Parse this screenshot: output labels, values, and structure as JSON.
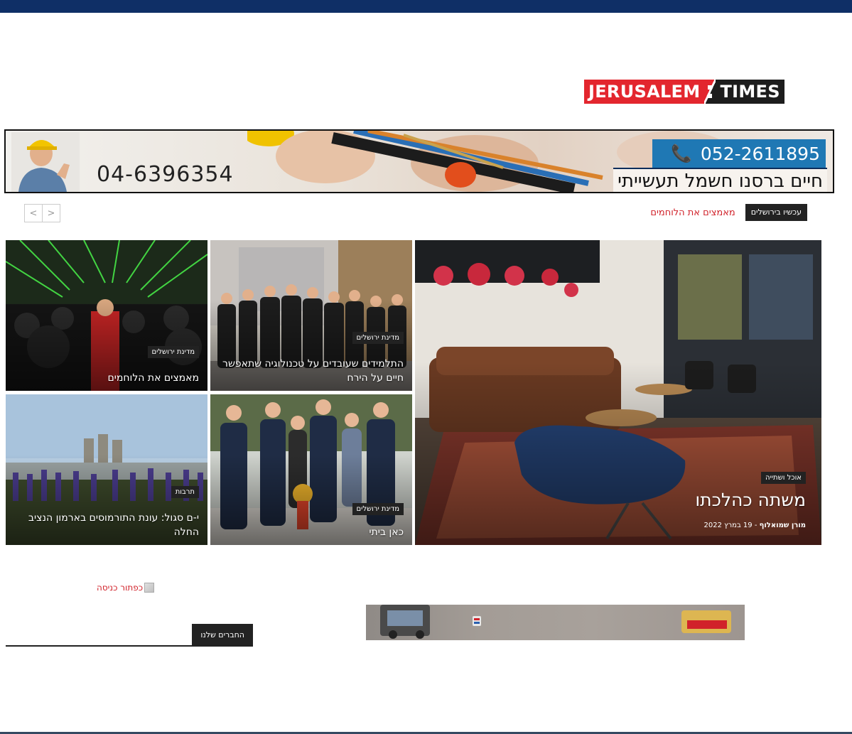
{
  "logo": {
    "part1": "JERUSALEM",
    "part2": "TIMES"
  },
  "banner": {
    "phone_left": "04-6396354",
    "phone_right": "052-2611895",
    "slogan": "חיים ברסנו חשמל תעשייתי",
    "phone_icon": "phone-icon"
  },
  "nav": {
    "prev": "<",
    "next": ">"
  },
  "ticker": {
    "label": "עכשיו בירושלים",
    "headline": "מאמצים את הלוחמים"
  },
  "featured": {
    "big": {
      "category": "אוכל ושתייה",
      "title": "משתה כהלכתו",
      "author": "מורן שמואלוף",
      "date": "19 במרץ 2022",
      "sep": " - "
    },
    "tiles": [
      {
        "category": "מדינת ירושלים",
        "title": "התלמידים שעובדים על טכנולוגיה שתאפשר חיים על הירח"
      },
      {
        "category": "מדינת ירושלים",
        "title": "מאמצים את הלוחמים"
      },
      {
        "category": "מדינת ירושלים",
        "title": "כאן ביתי"
      },
      {
        "category": "תרבות",
        "title": "י-ם סגול: עונת התורמוסים בארמון הנציב החלה"
      }
    ]
  },
  "broken_image_alt": "כפתור כניסה",
  "partners_tab": "החברים שלנו"
}
